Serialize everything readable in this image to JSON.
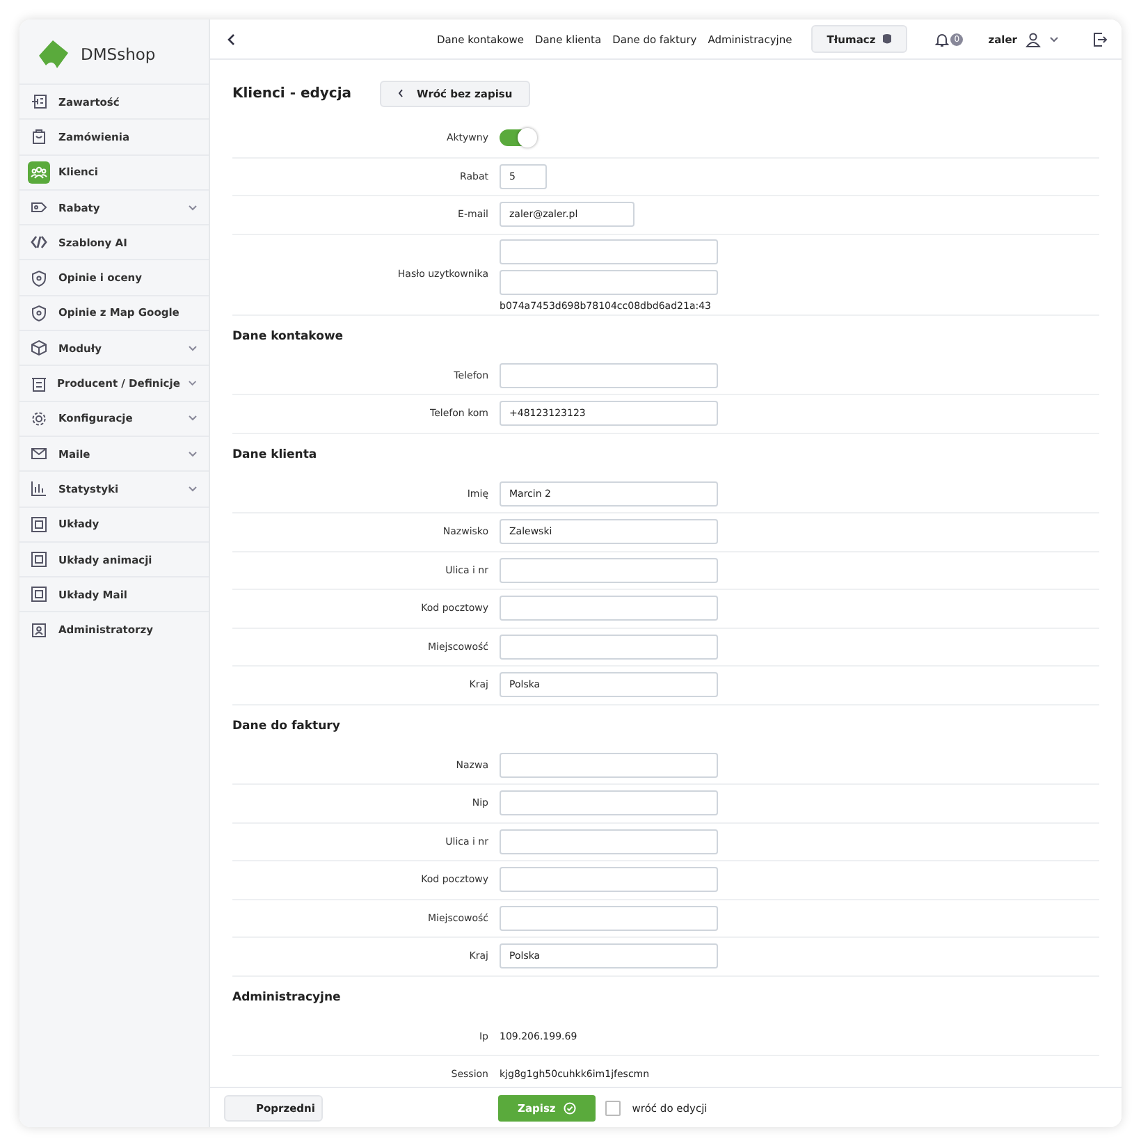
{
  "brand": "DMSshop",
  "sidebar": {
    "items": [
      {
        "label": "Zawartość",
        "expandable": false,
        "selected": false
      },
      {
        "label": "Zamówienia",
        "expandable": false,
        "selected": false
      },
      {
        "label": "Klienci",
        "expandable": false,
        "selected": true
      },
      {
        "label": "Rabaty",
        "expandable": true,
        "selected": false
      },
      {
        "label": "Szablony AI",
        "expandable": false,
        "selected": false
      },
      {
        "label": "Opinie i oceny",
        "expandable": false,
        "selected": false
      },
      {
        "label": "Opinie z Map Google",
        "expandable": false,
        "selected": false
      },
      {
        "label": "Moduły",
        "expandable": true,
        "selected": false
      },
      {
        "label": "Producent / Definicje",
        "expandable": true,
        "selected": false
      },
      {
        "label": "Konfiguracje",
        "expandable": true,
        "selected": false
      },
      {
        "label": "Maile",
        "expandable": true,
        "selected": false
      },
      {
        "label": "Statystyki",
        "expandable": true,
        "selected": false
      },
      {
        "label": "Układy",
        "expandable": false,
        "selected": false
      },
      {
        "label": "Układy animacji",
        "expandable": false,
        "selected": false
      },
      {
        "label": "Układy Mail",
        "expandable": false,
        "selected": false
      },
      {
        "label": "Administratorzy",
        "expandable": false,
        "selected": false
      }
    ]
  },
  "topbar": {
    "links": [
      "Dane kontakowe",
      "Dane klienta",
      "Dane do faktury",
      "Administracyjne"
    ],
    "translate_button": "Tłumacz",
    "notifications": "0",
    "user": "zaler"
  },
  "title": "Klienci - edycja",
  "back_button": "Wróć bez zapisu",
  "sections": [
    {
      "fields": [
        {
          "kind": "toggle",
          "label": "Aktywny",
          "on": true
        },
        {
          "kind": "short-input",
          "label": "Rabat",
          "value": "5"
        },
        {
          "kind": "medium-input",
          "label": "E-mail",
          "value": "zaler@zaler.pl"
        },
        {
          "kind": "password",
          "label": "Hasło uzytkownika",
          "hash": "b074a7453d698b78104cc08dbd6ad21a:43"
        }
      ]
    },
    {
      "heading": "Dane kontakowe",
      "fields": [
        {
          "kind": "input",
          "label": "Telefon"
        },
        {
          "kind": "input",
          "label": "Telefon kom",
          "value": "+48123123123"
        }
      ]
    },
    {
      "heading": "Dane klienta",
      "fields": [
        {
          "kind": "input",
          "label": "Imię",
          "value": "Marcin 2"
        },
        {
          "kind": "input",
          "label": "Nazwisko",
          "value": "Zalewski"
        },
        {
          "kind": "input",
          "label": "Ulica i nr"
        },
        {
          "kind": "input",
          "label": "Kod pocztowy"
        },
        {
          "kind": "input",
          "label": "Miejscowość"
        },
        {
          "kind": "input",
          "label": "Kraj",
          "value": "Polska"
        }
      ]
    },
    {
      "heading": "Dane do faktury",
      "fields": [
        {
          "kind": "input",
          "label": "Nazwa"
        },
        {
          "kind": "input",
          "label": "Nip"
        },
        {
          "kind": "input",
          "label": "Ulica i nr"
        },
        {
          "kind": "input",
          "label": "Kod pocztowy"
        },
        {
          "kind": "input",
          "label": "Miejscowość"
        },
        {
          "kind": "input",
          "label": "Kraj",
          "value": "Polska"
        }
      ]
    },
    {
      "heading": "Administracyjne",
      "fields": [
        {
          "kind": "text",
          "label": "Ip",
          "value": "109.206.199.69"
        },
        {
          "kind": "text",
          "label": "Session",
          "value": "kjg8g1gh50cuhkk6im1jfescmn"
        }
      ]
    }
  ],
  "footer": {
    "prev_button": "Poprzedni",
    "save_button": "Zapisz",
    "return_checkbox": {
      "label": "wróć do edycji",
      "checked": false
    }
  }
}
